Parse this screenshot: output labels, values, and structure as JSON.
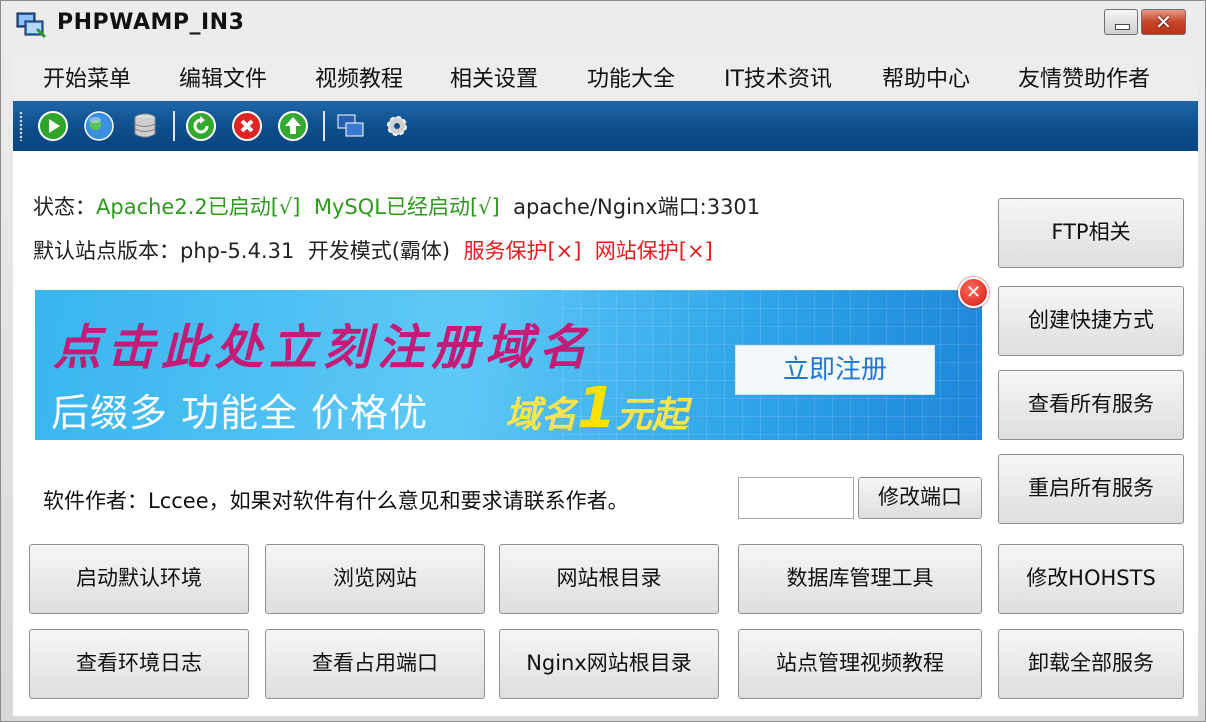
{
  "window": {
    "title": "PHPWAMP_IN3",
    "close_glyph": "✕"
  },
  "menu": [
    "开始菜单",
    "编辑文件",
    "视频教程",
    "相关设置",
    "功能大全",
    "IT技术资讯",
    "帮助中心",
    "友情赞助作者"
  ],
  "toolbar": {
    "icons": [
      "start-icon",
      "globe-icon",
      "database-icon",
      "refresh-icon",
      "stop-icon",
      "upload-icon",
      "app-icon",
      "gear-icon"
    ]
  },
  "status": {
    "label": "状态：",
    "apache": "Apache2.2已启动[√]",
    "mysql": "MySQL已经启动[√]",
    "port": "apache/Nginx端口:3301"
  },
  "status2": {
    "version": "默认站点版本：php-5.4.31",
    "mode": "开发模式(霸体)",
    "service_protect": "服务保护[×]",
    "site_protect": "网站保护[×]"
  },
  "banner": {
    "headline": "点击此处立刻注册域名",
    "subline": "后缀多 功能全 价格优",
    "promo_prefix": "域名",
    "promo_number": "1",
    "promo_suffix": "元起",
    "cta": "立即注册",
    "close_glyph": "✕"
  },
  "author_text": "软件作者：Lccee，如果对软件有什么意见和要求请联系作者。",
  "port_input": {
    "value": ""
  },
  "buttons": {
    "modify_port": "修改端口",
    "ftp": "FTP相关",
    "shortcut": "创建快捷方式",
    "view_services": "查看所有服务",
    "restart_services": "重启所有服务",
    "modify_hosts": "修改HOHSTS",
    "uninstall": "卸载全部服务",
    "start_env": "启动默认环境",
    "browse_site": "浏览网站",
    "site_root": "网站根目录",
    "db_tools": "数据库管理工具",
    "env_log": "查看环境日志",
    "ports_in_use": "查看占用端口",
    "nginx_root": "Nginx网站根目录",
    "site_video": "站点管理视频教程"
  }
}
